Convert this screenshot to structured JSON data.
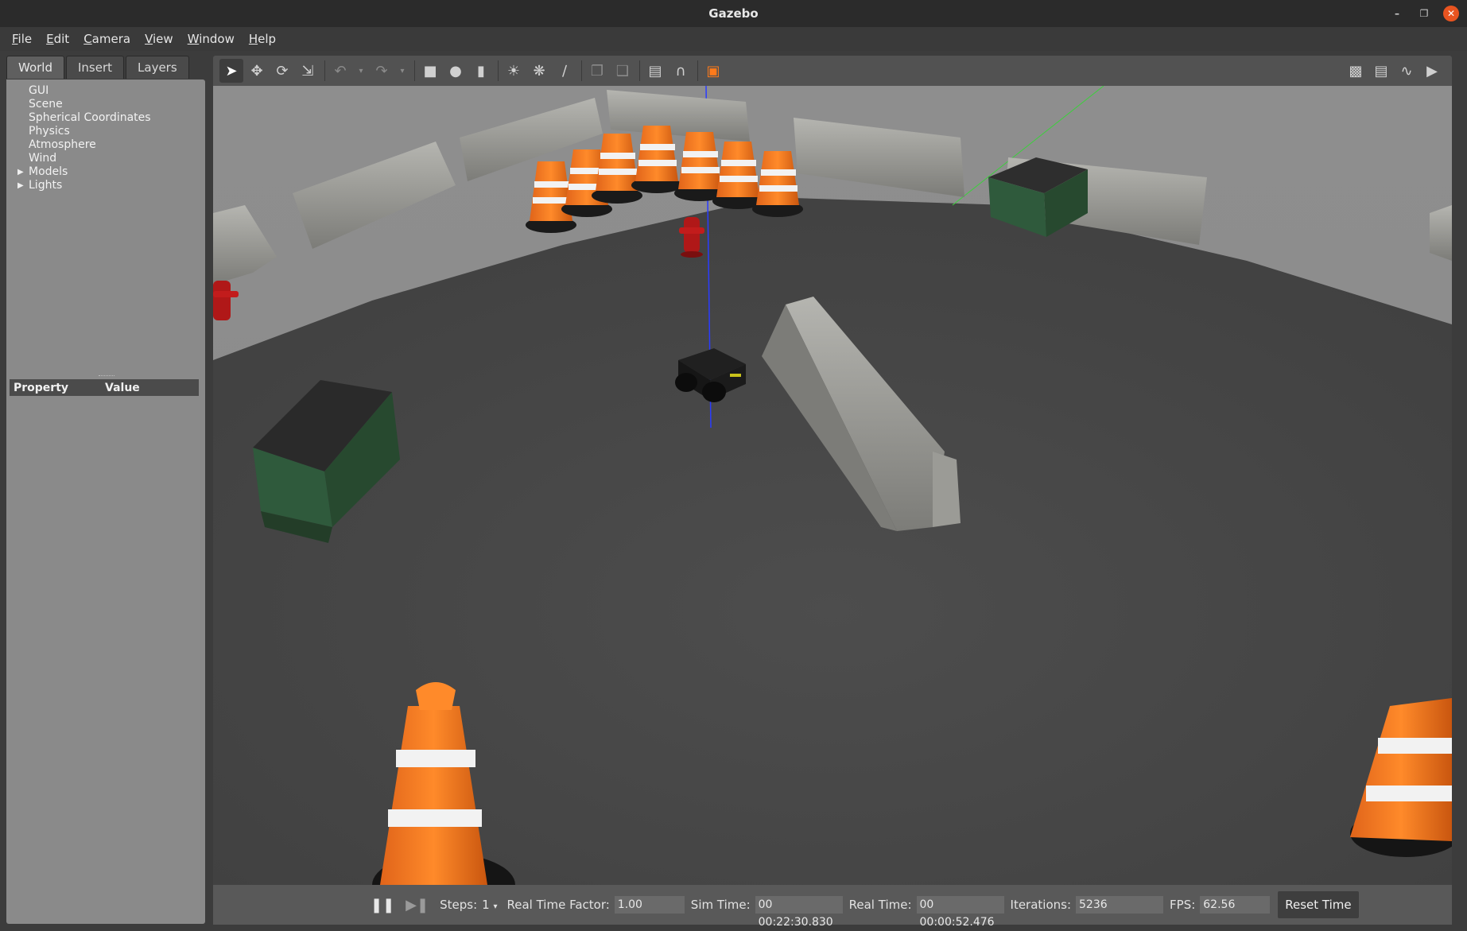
{
  "window": {
    "title": "Gazebo"
  },
  "menu": [
    {
      "label": "File",
      "key": "F",
      "rest": "ile"
    },
    {
      "label": "Edit",
      "key": "E",
      "rest": "dit"
    },
    {
      "label": "Camera",
      "key": "C",
      "rest": "amera"
    },
    {
      "label": "View",
      "key": "V",
      "rest": "iew"
    },
    {
      "label": "Window",
      "key": "W",
      "rest": "indow"
    },
    {
      "label": "Help",
      "key": "H",
      "rest": "elp"
    }
  ],
  "left_panel": {
    "tabs": [
      "World",
      "Insert",
      "Layers"
    ],
    "active_tab": "World",
    "tree": [
      "GUI",
      "Scene",
      "Spherical Coordinates",
      "Physics",
      "Atmosphere",
      "Wind",
      "Models",
      "Lights"
    ],
    "property_header": "Property",
    "value_header": "Value"
  },
  "toolbar": {
    "icons": [
      "select-arrow-icon",
      "translate-icon",
      "rotate-icon",
      "scale-icon",
      "undo-icon",
      "redo-icon",
      "box-icon",
      "sphere-icon",
      "cylinder-icon",
      "point-light-icon",
      "spot-light-icon",
      "directional-light-icon",
      "copy-icon",
      "paste-icon",
      "align-icon",
      "magnet-icon",
      "view-angle-icon",
      "screenshot-icon",
      "log-icon",
      "plot-icon",
      "record-video-icon"
    ]
  },
  "status": {
    "steps_label": "Steps:",
    "steps_value": "1",
    "rtf_label": "Real Time Factor:",
    "rtf_value": "1.00",
    "sim_time_label": "Sim Time:",
    "sim_time_value": "00 00:22:30.830",
    "real_time_label": "Real Time:",
    "real_time_value": "00 00:00:52.476",
    "iterations_label": "Iterations:",
    "iterations_value": "5236",
    "fps_label": "FPS:",
    "fps_value": "62.56",
    "reset_label": "Reset Time"
  },
  "colors": {
    "cone_orange": "#ff7a1a",
    "dumpster_green": "#2f5a3c",
    "barrier_gray": "#a9a9a4",
    "ground": "#4a4a4a"
  }
}
